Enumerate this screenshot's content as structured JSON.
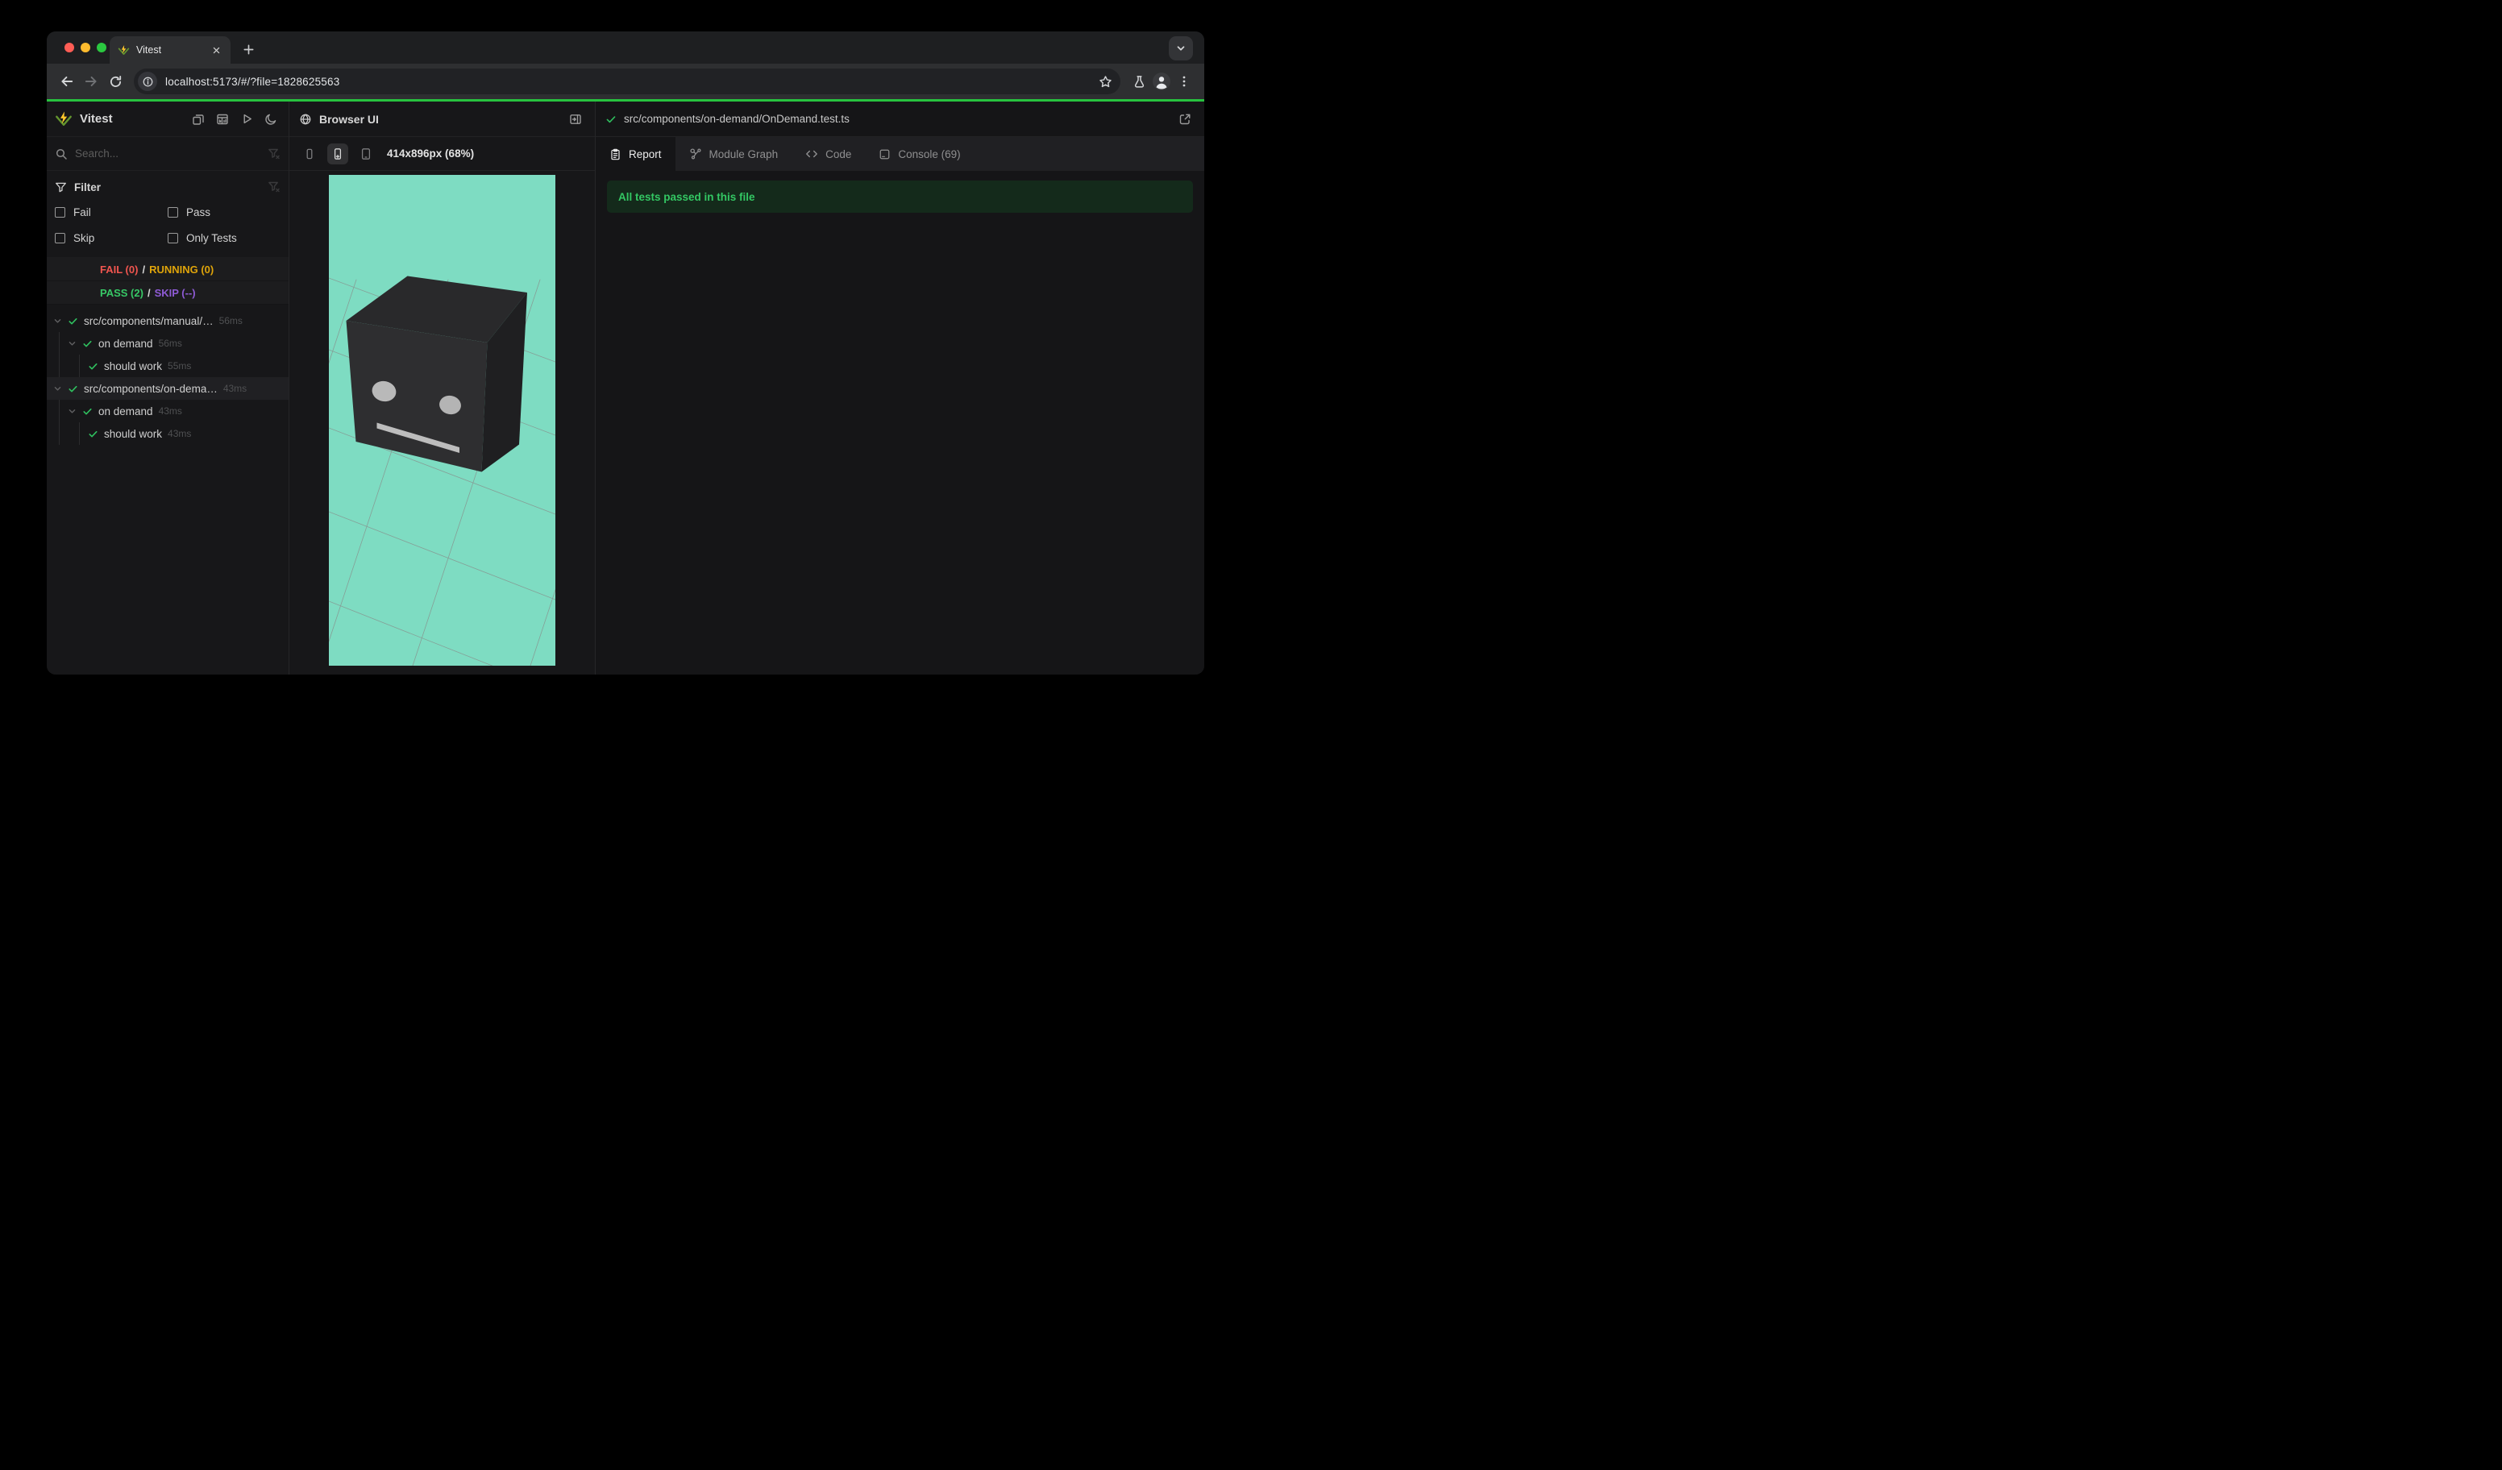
{
  "browser": {
    "tab": {
      "title": "Vitest"
    },
    "url": "localhost:5173/#/?file=1828625563"
  },
  "sidebar": {
    "title": "Vitest",
    "search_placeholder": "Search...",
    "filter": {
      "title": "Filter",
      "options": [
        {
          "label": "Fail"
        },
        {
          "label": "Pass"
        },
        {
          "label": "Skip"
        },
        {
          "label": "Only Tests"
        }
      ]
    },
    "summary": {
      "fail": "FAIL (0)",
      "running": "RUNNING (0)",
      "pass": "PASS (2)",
      "skip": "SKIP (--)",
      "separator": "/"
    },
    "tree": [
      {
        "label": "src/components/manual/…",
        "duration": "56ms"
      },
      {
        "label": "on demand",
        "duration": "56ms"
      },
      {
        "label": "should work",
        "duration": "55ms"
      },
      {
        "label": "src/components/on-dema…",
        "duration": "43ms"
      },
      {
        "label": "on demand",
        "duration": "43ms"
      },
      {
        "label": "should work",
        "duration": "43ms"
      }
    ]
  },
  "browser_panel": {
    "title": "Browser UI",
    "viewport_size": "414x896px (68%)"
  },
  "report_panel": {
    "file_path": "src/components/on-demand/OnDemand.test.ts",
    "tabs": [
      {
        "label": "Report"
      },
      {
        "label": "Module Graph"
      },
      {
        "label": "Code"
      },
      {
        "label": "Console (69)"
      }
    ],
    "banner": "All tests passed in this file"
  },
  "colors": {
    "progress_green": "#27c23f",
    "fail_red": "#f0554f",
    "running_yellow": "#dfa40a",
    "pass_green": "#37c866",
    "skip_purple": "#8f5bd6",
    "check_green": "#2fc05f",
    "viewport_background": "#7edcc2",
    "banner_background": "#142a1b",
    "banner_text": "#33c763",
    "logo_green": "#63952e",
    "logo_yellow": "#fcc72b"
  }
}
